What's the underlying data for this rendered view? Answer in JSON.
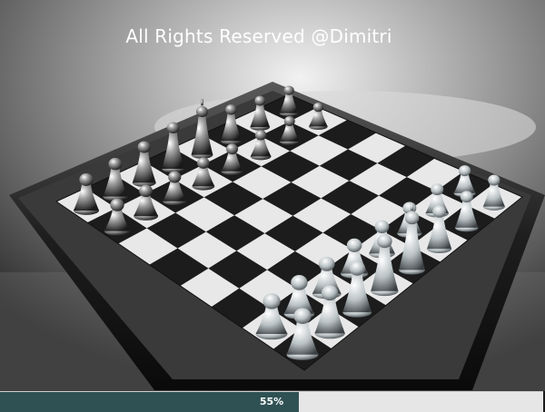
{
  "scene": {
    "watermark": "All Rights Reserved @Dimitri",
    "board": {
      "light_square": "#e8e8e8",
      "dark_square": "#1c1c1c",
      "frame": "#2a2a2a"
    },
    "pieces": {
      "dark_set_color": "#8a8a8a",
      "light_set_color": "#b9c1c4",
      "dark_set": [
        "rook",
        "knight",
        "bishop",
        "queen",
        "king",
        "bishop",
        "knight",
        "rook",
        "pawn",
        "pawn",
        "pawn",
        "pawn",
        "pawn",
        "pawn",
        "pawn",
        "pawn"
      ],
      "light_set": [
        "rook",
        "knight",
        "bishop",
        "queen",
        "king",
        "bishop",
        "knight",
        "rook",
        "pawn",
        "pawn",
        "pawn",
        "pawn",
        "pawn",
        "pawn",
        "pawn",
        "pawn"
      ]
    }
  },
  "progress": {
    "value": 0.55,
    "label": "55%",
    "fill_color": "#2f5153",
    "track_color": "#e6e6e6"
  }
}
